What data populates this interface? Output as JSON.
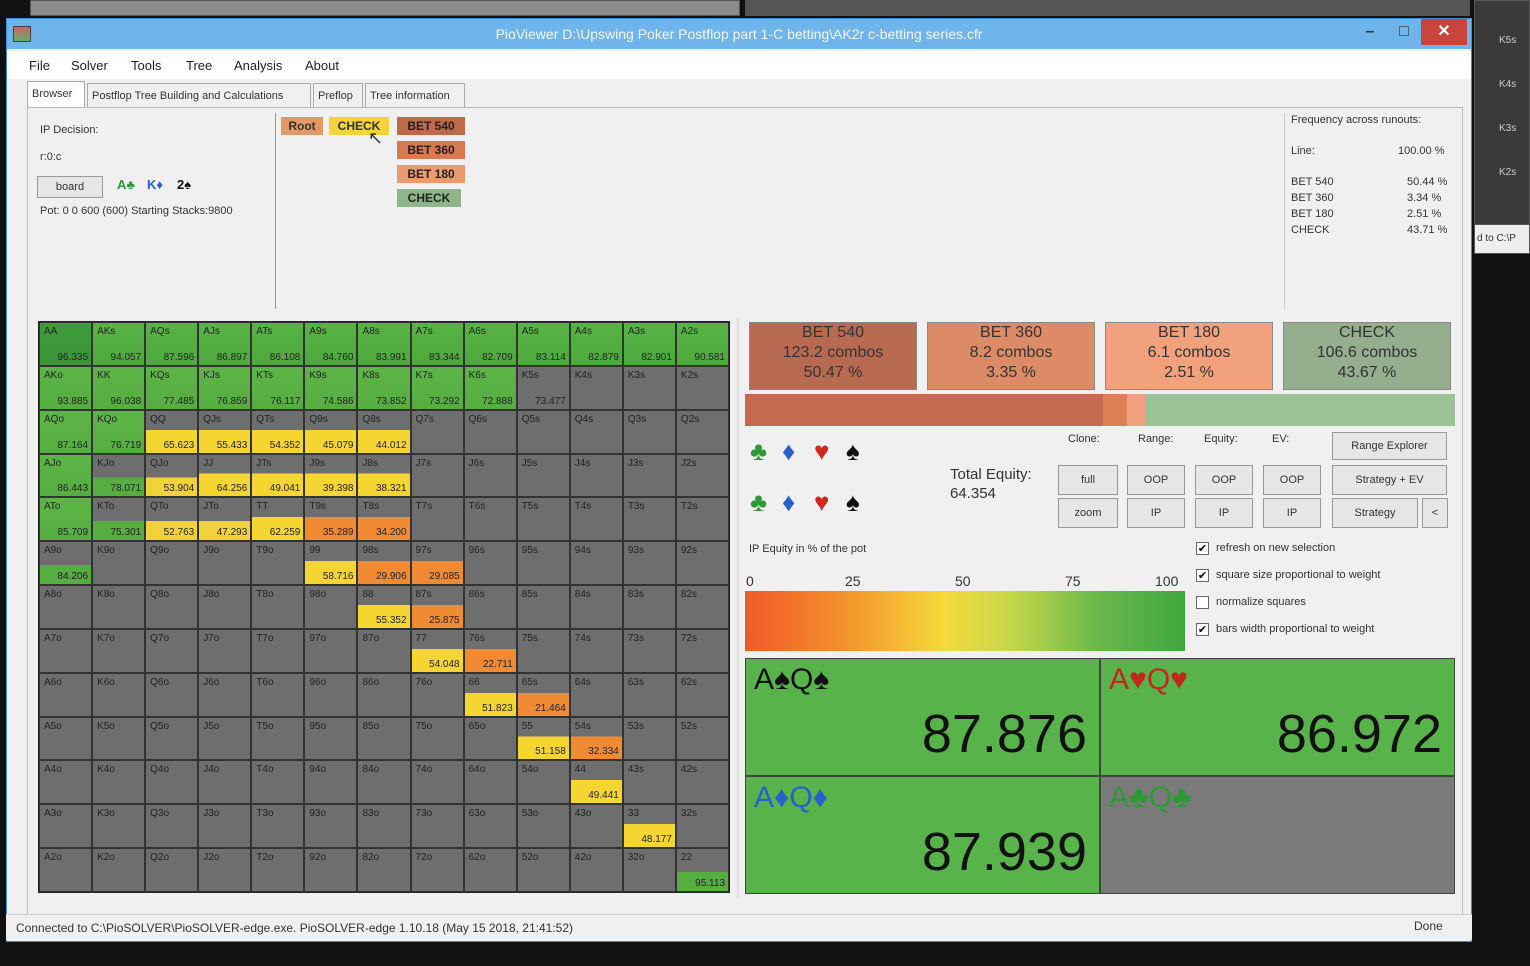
{
  "window": {
    "title": "PioViewer D:\\Upswing Poker Postflop part 1-C betting\\AK2r c-betting series.cfr"
  },
  "menu": [
    "File",
    "Solver",
    "Tools",
    "Tree",
    "Analysis",
    "About"
  ],
  "tabs": [
    "Browser",
    "Postflop Tree Building and Calculations",
    "Preflop",
    "Tree information"
  ],
  "decision": {
    "title": "IP Decision:",
    "path": "r:0:c",
    "board_button": "board",
    "cards": [
      "A♣",
      "K♦",
      "2♠"
    ],
    "pot": "Pot: 0 0 600 (600) Starting Stacks:9800"
  },
  "tree": {
    "root": "Root",
    "check": "CHECK",
    "options": [
      "BET 540",
      "BET 360",
      "BET 180",
      "CHECK"
    ]
  },
  "freq": {
    "title": "Frequency across runouts:",
    "line_label": "Line:",
    "line_value": "100.00 %",
    "rows": [
      [
        "BET 540",
        "50.44 %"
      ],
      [
        "BET 360",
        "3.34 %"
      ],
      [
        "BET 180",
        "2.51 %"
      ],
      [
        "CHECK",
        "43.71 %"
      ]
    ]
  },
  "actions": [
    {
      "name": "BET 540",
      "combos": "123.2 combos",
      "pct": "50.47 %",
      "color": "#b86a50"
    },
    {
      "name": "BET 360",
      "combos": "8.2 combos",
      "pct": "3.35 %",
      "color": "#dd8a66"
    },
    {
      "name": "BET 180",
      "combos": "6.1 combos",
      "pct": "2.51 %",
      "color": "#f1a27c"
    },
    {
      "name": "CHECK",
      "combos": "106.6 combos",
      "pct": "43.67 %",
      "color": "#94ae8e"
    }
  ],
  "action_bar_frac": [
    0.5047,
    0.0335,
    0.0251,
    0.4367
  ],
  "controls": {
    "headers": [
      "Clone:",
      "Range:",
      "Equity:",
      "EV:"
    ],
    "row1": [
      "full",
      "OOP",
      "OOP",
      "OOP"
    ],
    "row2": [
      "zoom",
      "IP",
      "IP",
      "IP"
    ],
    "right": [
      "Range Explorer",
      "Strategy + EV",
      "Strategy"
    ],
    "back": "<",
    "total_equity_label": "Total Equity:",
    "total_equity_value": "64.354",
    "equity_caption": "IP Equity in % of the pot",
    "scale": [
      "0",
      "25",
      "50",
      "75",
      "100"
    ]
  },
  "checkboxes": [
    {
      "label": "refresh on new selection",
      "checked": true
    },
    {
      "label": "square size proportional to weight",
      "checked": true
    },
    {
      "label": "normalize squares",
      "checked": false
    },
    {
      "label": "bars width proportional to weight",
      "checked": true
    }
  ],
  "suit_icons": {
    "clubs": "♣",
    "diamonds": "♦",
    "hearts": "♥",
    "spades": "♠"
  },
  "equities": [
    {
      "hand": "A♠Q♠",
      "value": "87.876",
      "color": "#111111",
      "bg": "#58b34a"
    },
    {
      "hand": "A♥Q♥",
      "value": "86.972",
      "color": "#c0281e",
      "bg": "#58b34a"
    },
    {
      "hand": "A♦Q♦",
      "value": "87.939",
      "color": "#2a5fd0",
      "bg": "#58b34a"
    },
    {
      "hand": "A♣Q♣",
      "value": "",
      "color": "#2e9a35",
      "bg": "#7a7a7a"
    }
  ],
  "status": {
    "left": "Connected to C:\\PioSOLVER\\PioSOLVER-edge.exe. PioSOLVER-edge 1.10.18 (May 15 2018, 21:41:52)",
    "right": "Done"
  },
  "bg_labels": [
    "K5s",
    "K4s",
    "K3s",
    "K2s",
    "d to C:\\P"
  ],
  "matrix": [
    [
      [
        "AA",
        "96.335",
        "g"
      ],
      [
        "AKs",
        "94.057",
        "g"
      ],
      [
        "AQs",
        "87.596",
        "g"
      ],
      [
        "AJs",
        "86.897",
        "g"
      ],
      [
        "ATs",
        "86.108",
        "g"
      ],
      [
        "A9s",
        "84.760",
        "g"
      ],
      [
        "A8s",
        "83.991",
        "g"
      ],
      [
        "A7s",
        "83.344",
        "g"
      ],
      [
        "A6s",
        "82.709",
        "g"
      ],
      [
        "A5s",
        "83.114",
        "g"
      ],
      [
        "A4s",
        "82.879",
        "g"
      ],
      [
        "A3s",
        "82.901",
        "g"
      ],
      [
        "A2s",
        "90.581",
        "g"
      ]
    ],
    [
      [
        "AKo",
        "93.885",
        "g"
      ],
      [
        "KK",
        "96.038",
        "g"
      ],
      [
        "KQs",
        "77.485",
        "g"
      ],
      [
        "KJs",
        "76.859",
        "g"
      ],
      [
        "KTs",
        "76.117",
        "g"
      ],
      [
        "K9s",
        "74.586",
        "g"
      ],
      [
        "K8s",
        "73.852",
        "g"
      ],
      [
        "K7s",
        "73.292",
        "g"
      ],
      [
        "K6s",
        "72.888",
        "g"
      ],
      [
        "K5s",
        "73.477",
        "x"
      ],
      [
        "K4s",
        "",
        "x"
      ],
      [
        "K3s",
        "",
        "x"
      ],
      [
        "K2s",
        "",
        "x"
      ]
    ],
    [
      [
        "AQo",
        "87.164",
        "g"
      ],
      [
        "KQo",
        "76.719",
        "g"
      ],
      [
        "QQ",
        "65.623",
        "y"
      ],
      [
        "QJs",
        "55.433",
        "y"
      ],
      [
        "QTs",
        "54.352",
        "y"
      ],
      [
        "Q9s",
        "45.079",
        "y"
      ],
      [
        "Q8s",
        "44.012",
        "y"
      ],
      [
        "Q7s",
        "",
        "x"
      ],
      [
        "Q6s",
        "",
        "x"
      ],
      [
        "Q5s",
        "",
        "x"
      ],
      [
        "Q4s",
        "",
        "x"
      ],
      [
        "Q3s",
        "",
        "x"
      ],
      [
        "Q2s",
        "",
        "x"
      ]
    ],
    [
      [
        "AJo",
        "86.443",
        "g"
      ],
      [
        "KJo",
        "78.071",
        "gx"
      ],
      [
        "QJo",
        "53.904",
        "yx"
      ],
      [
        "JJ",
        "64.256",
        "y"
      ],
      [
        "JTs",
        "49.041",
        "y"
      ],
      [
        "J9s",
        "39.398",
        "y"
      ],
      [
        "J8s",
        "38.321",
        "y"
      ],
      [
        "J7s",
        "",
        "x"
      ],
      [
        "J6s",
        "",
        "x"
      ],
      [
        "J5s",
        "",
        "x"
      ],
      [
        "J4s",
        "",
        "x"
      ],
      [
        "J3s",
        "",
        "x"
      ],
      [
        "J2s",
        "",
        "x"
      ]
    ],
    [
      [
        "ATo",
        "85.709",
        "g"
      ],
      [
        "KTo",
        "75.301",
        "gx"
      ],
      [
        "QTo",
        "52.763",
        "yx"
      ],
      [
        "JTo",
        "47.293",
        "yx"
      ],
      [
        "TT",
        "62.259",
        "y"
      ],
      [
        "T9s",
        "35.289",
        "o"
      ],
      [
        "T8s",
        "34.200",
        "o"
      ],
      [
        "T7s",
        "",
        "x"
      ],
      [
        "T6s",
        "",
        "x"
      ],
      [
        "T5s",
        "",
        "x"
      ],
      [
        "T4s",
        "",
        "x"
      ],
      [
        "T3s",
        "",
        "x"
      ],
      [
        "T2s",
        "",
        "x"
      ]
    ],
    [
      [
        "A9o",
        "84.206",
        "gx"
      ],
      [
        "K9o",
        "",
        "x"
      ],
      [
        "Q9o",
        "",
        "x"
      ],
      [
        "J9o",
        "",
        "x"
      ],
      [
        "T9o",
        "",
        "x"
      ],
      [
        "99",
        "58.716",
        "y"
      ],
      [
        "98s",
        "29.906",
        "o"
      ],
      [
        "97s",
        "29.085",
        "o"
      ],
      [
        "96s",
        "",
        "x"
      ],
      [
        "95s",
        "",
        "x"
      ],
      [
        "94s",
        "",
        "x"
      ],
      [
        "93s",
        "",
        "x"
      ],
      [
        "92s",
        "",
        "x"
      ]
    ],
    [
      [
        "A8o",
        "",
        "x"
      ],
      [
        "K8o",
        "",
        "x"
      ],
      [
        "Q8o",
        "",
        "x"
      ],
      [
        "J8o",
        "",
        "x"
      ],
      [
        "T8o",
        "",
        "x"
      ],
      [
        "98o",
        "",
        "x"
      ],
      [
        "88",
        "55.352",
        "y"
      ],
      [
        "87s",
        "25.875",
        "o"
      ],
      [
        "86s",
        "",
        "x"
      ],
      [
        "85s",
        "",
        "x"
      ],
      [
        "84s",
        "",
        "x"
      ],
      [
        "83s",
        "",
        "x"
      ],
      [
        "82s",
        "",
        "x"
      ]
    ],
    [
      [
        "A7o",
        "",
        "x"
      ],
      [
        "K7o",
        "",
        "x"
      ],
      [
        "Q7o",
        "",
        "x"
      ],
      [
        "J7o",
        "",
        "x"
      ],
      [
        "T7o",
        "",
        "x"
      ],
      [
        "97o",
        "",
        "x"
      ],
      [
        "87o",
        "",
        "x"
      ],
      [
        "77",
        "54.048",
        "y"
      ],
      [
        "76s",
        "22.711",
        "o"
      ],
      [
        "75s",
        "",
        "x"
      ],
      [
        "74s",
        "",
        "x"
      ],
      [
        "73s",
        "",
        "x"
      ],
      [
        "72s",
        "",
        "x"
      ]
    ],
    [
      [
        "A6o",
        "",
        "x"
      ],
      [
        "K6o",
        "",
        "x"
      ],
      [
        "Q6o",
        "",
        "x"
      ],
      [
        "J6o",
        "",
        "x"
      ],
      [
        "T6o",
        "",
        "x"
      ],
      [
        "96o",
        "",
        "x"
      ],
      [
        "86o",
        "",
        "x"
      ],
      [
        "76o",
        "",
        "x"
      ],
      [
        "66",
        "51.823",
        "y"
      ],
      [
        "65s",
        "21.464",
        "o"
      ],
      [
        "64s",
        "",
        "x"
      ],
      [
        "63s",
        "",
        "x"
      ],
      [
        "62s",
        "",
        "x"
      ]
    ],
    [
      [
        "A5o",
        "",
        "x"
      ],
      [
        "K5o",
        "",
        "x"
      ],
      [
        "Q5o",
        "",
        "x"
      ],
      [
        "J5o",
        "",
        "x"
      ],
      [
        "T5o",
        "",
        "x"
      ],
      [
        "95o",
        "",
        "x"
      ],
      [
        "85o",
        "",
        "x"
      ],
      [
        "75o",
        "",
        "x"
      ],
      [
        "65o",
        "",
        "x"
      ],
      [
        "55",
        "51.158",
        "y"
      ],
      [
        "54s",
        "32.334",
        "o"
      ],
      [
        "53s",
        "",
        "x"
      ],
      [
        "52s",
        "",
        "x"
      ]
    ],
    [
      [
        "A4o",
        "",
        "x"
      ],
      [
        "K4o",
        "",
        "x"
      ],
      [
        "Q4o",
        "",
        "x"
      ],
      [
        "J4o",
        "",
        "x"
      ],
      [
        "T4o",
        "",
        "x"
      ],
      [
        "94o",
        "",
        "x"
      ],
      [
        "84o",
        "",
        "x"
      ],
      [
        "74o",
        "",
        "x"
      ],
      [
        "64o",
        "",
        "x"
      ],
      [
        "54o",
        "",
        "x"
      ],
      [
        "44",
        "49.441",
        "y"
      ],
      [
        "43s",
        "",
        "x"
      ],
      [
        "42s",
        "",
        "x"
      ]
    ],
    [
      [
        "A3o",
        "",
        "x"
      ],
      [
        "K3o",
        "",
        "x"
      ],
      [
        "Q3o",
        "",
        "x"
      ],
      [
        "J3o",
        "",
        "x"
      ],
      [
        "T3o",
        "",
        "x"
      ],
      [
        "93o",
        "",
        "x"
      ],
      [
        "83o",
        "",
        "x"
      ],
      [
        "73o",
        "",
        "x"
      ],
      [
        "63o",
        "",
        "x"
      ],
      [
        "53o",
        "",
        "x"
      ],
      [
        "43o",
        "",
        "x"
      ],
      [
        "33",
        "48.177",
        "y"
      ],
      [
        "32s",
        "",
        "x"
      ]
    ],
    [
      [
        "A2o",
        "",
        "x"
      ],
      [
        "K2o",
        "",
        "x"
      ],
      [
        "Q2o",
        "",
        "x"
      ],
      [
        "J2o",
        "",
        "x"
      ],
      [
        "T2o",
        "",
        "x"
      ],
      [
        "92o",
        "",
        "x"
      ],
      [
        "82o",
        "",
        "x"
      ],
      [
        "72o",
        "",
        "x"
      ],
      [
        "62o",
        "",
        "x"
      ],
      [
        "52o",
        "",
        "x"
      ],
      [
        "42o",
        "",
        "x"
      ],
      [
        "32o",
        "",
        "x"
      ],
      [
        "22",
        "95.113",
        "gx"
      ]
    ]
  ]
}
